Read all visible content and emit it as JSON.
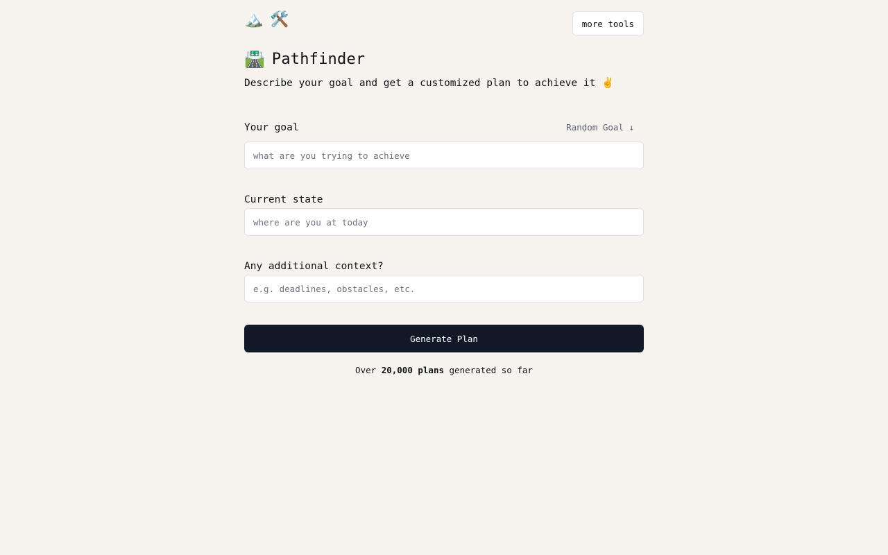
{
  "header": {
    "logo_icons": [
      "🏔️",
      "🛠️"
    ],
    "more_tools_label": "more tools"
  },
  "hero": {
    "title_icon": "🛣️",
    "title": "Pathfinder",
    "subtitle": "Describe your goal and get a customized plan to achieve it",
    "subtitle_emoji": "✌️"
  },
  "form": {
    "goal": {
      "label": "Your goal",
      "random_label": "Random Goal ↓",
      "value": "",
      "placeholder": "what are you trying to achieve"
    },
    "current_state": {
      "label": "Current state",
      "value": "",
      "placeholder": "where are you at today"
    },
    "context": {
      "label": "Any additional context?",
      "value": "",
      "placeholder": "e.g. deadlines, obstacles, etc."
    },
    "submit_label": "Generate Plan"
  },
  "stats": {
    "prefix": "Over",
    "count": "20,000 plans",
    "suffix": "generated so far"
  },
  "colors": {
    "background": "#f7f4f0",
    "primary_button": "#111827",
    "muted_text": "#5b6473"
  }
}
